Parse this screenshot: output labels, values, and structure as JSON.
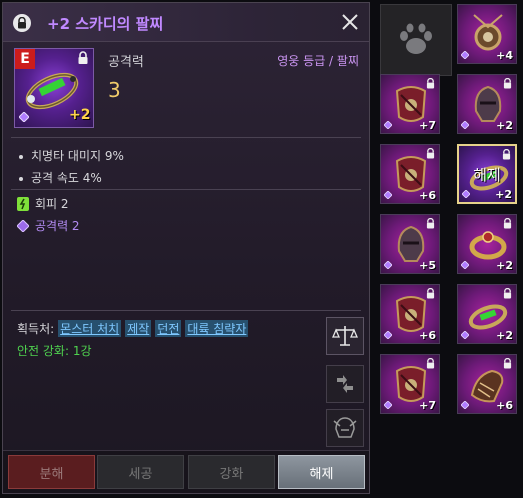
{
  "tooltip": {
    "title": "+2 스카디의 팔찌",
    "grade_letter": "E",
    "enhance_badge": "+2",
    "stat_label": "공격력",
    "stat_value": "3",
    "grade_type": "영웅 등급 / 팔찌",
    "bonus_stats": [
      "치명타 대미지 9%",
      "공격 속도 4%"
    ],
    "green_stat": "회피 2",
    "purple_stat": "공격력 2",
    "source_label": "획득처:",
    "sources": [
      "몬스터 처치",
      "제작",
      "던전",
      "대륙 침략자"
    ],
    "safe_enhance": "안전 강화: 1강"
  },
  "buttons": {
    "disassemble": "분해",
    "finesse": "세공",
    "enhance": "강화",
    "unlock": "해제"
  },
  "colors": {
    "title": "#c089ff",
    "stat_value": "#f1cc6a",
    "safe": "#4fd24f",
    "link": "#7fc8ff"
  },
  "grid": {
    "top_slot_icon": "paw-icon",
    "slots": [
      {
        "enh": "+4",
        "locked": false,
        "art": "necklace"
      },
      {
        "enh": "+7",
        "locked": true,
        "art": "armor"
      },
      {
        "enh": "+2",
        "locked": true,
        "art": "helm"
      },
      {
        "enh": "+6",
        "locked": true,
        "art": "armor"
      },
      {
        "enh": "+2",
        "locked": true,
        "art": "bracelet",
        "selected": true,
        "overlay": "해제"
      },
      {
        "enh": "+5",
        "locked": true,
        "art": "helm"
      },
      {
        "enh": "+2",
        "locked": true,
        "art": "ring"
      },
      {
        "enh": "+6",
        "locked": true,
        "art": "armor"
      },
      {
        "enh": "+2",
        "locked": true,
        "art": "bracelet"
      },
      {
        "enh": "+7",
        "locked": true,
        "art": "armor"
      },
      {
        "enh": "+6",
        "locked": true,
        "art": "gauntlet"
      }
    ]
  }
}
